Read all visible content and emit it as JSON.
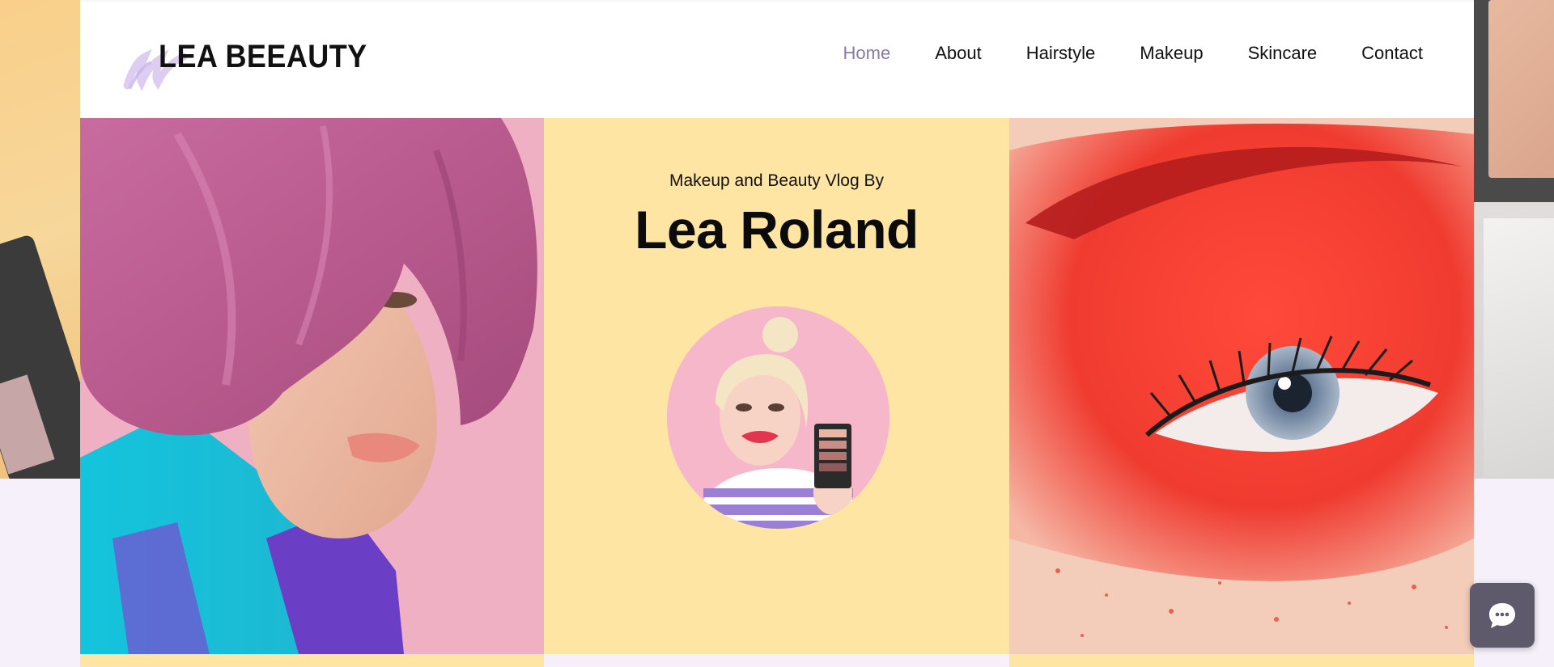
{
  "brand": {
    "logo_text": "LEA BEEAUTY",
    "accent_color": "#8a7aa8",
    "hero_center_color": "#fee5a3",
    "lavender_color": "#f6f0fb"
  },
  "nav": {
    "items": [
      {
        "label": "Home",
        "active": true
      },
      {
        "label": "About",
        "active": false
      },
      {
        "label": "Hairstyle",
        "active": false
      },
      {
        "label": "Makeup",
        "active": false
      },
      {
        "label": "Skincare",
        "active": false
      },
      {
        "label": "Contact",
        "active": false
      }
    ]
  },
  "hero": {
    "subtitle": "Makeup and Beauty Vlog By",
    "name": "Lea Roland",
    "left_image": "pink-haired-model-photo",
    "portrait_image": "blonde-woman-with-palette-photo",
    "right_image": "red-eye-makeup-closeup-photo"
  },
  "chat": {
    "icon": "chat-bubble-icon"
  }
}
